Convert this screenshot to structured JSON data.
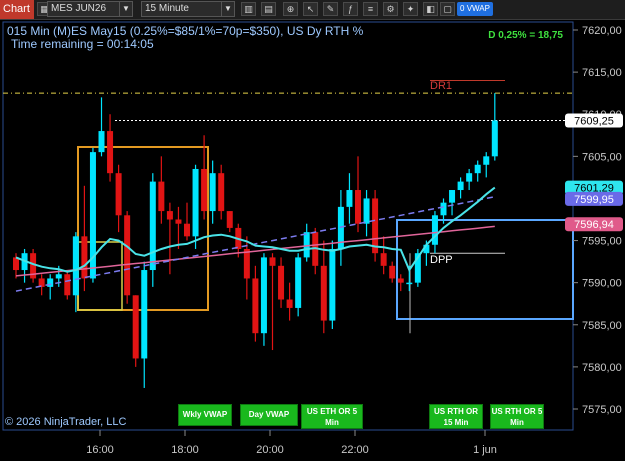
{
  "toolbar": {
    "chart_label": "Chart",
    "instrument": "MES JUN26",
    "interval": "15 Minute",
    "vwap_button": "0 VWAP"
  },
  "header": {
    "line1": "015 Min (M)ES May15  (0.25%=$85/1%=70p=$350), US Dy RTH %",
    "line2": "Time remaining = 00:14:05",
    "stat": "D 0,25% = 18,75"
  },
  "labels": {
    "dr1": "DR1",
    "dpp": "DPP",
    "copyright": "© 2026 NinjaTrader, LLC"
  },
  "price_axis": {
    "ticks": [
      "7620,00",
      "7615,00",
      "7610,00",
      "7605,00",
      "7600,00",
      "7595,00",
      "7590,00",
      "7585,00",
      "7580,00",
      "7575,00"
    ],
    "markers": [
      {
        "label": "7609,25",
        "color": "#ffffff",
        "text_color": "#000000"
      },
      {
        "label": "7601,29",
        "color": "#2ee6ee",
        "text_color": "#000000"
      },
      {
        "label": "7599,95",
        "color": "#6a6ae8",
        "text_color": "#ffffff"
      },
      {
        "label": "7596,94",
        "color": "#e05a8a",
        "text_color": "#ffffff"
      }
    ]
  },
  "time_axis": {
    "ticks": [
      "16:00",
      "18:00",
      "20:00",
      "22:00",
      "1 jun"
    ]
  },
  "buttons": [
    {
      "label": "Wkly VWAP"
    },
    {
      "label": "Day VWAP"
    },
    {
      "label": "US ETH OR 5 Min"
    },
    {
      "label": "US RTH OR 15 Min"
    },
    {
      "label": "US RTH OR 5 Min"
    }
  ],
  "colors": {
    "up": "#00e5ff",
    "down": "#e11414",
    "vwap": "#49e3e8",
    "dr1": "#c0392b"
  },
  "chart_data": {
    "type": "candlestick",
    "ylim": [
      7572,
      7622
    ],
    "ohlc": [
      [
        7593.0,
        7593.5,
        7590.5,
        7591.5
      ],
      [
        7591.5,
        7594.0,
        7590.0,
        7593.5
      ],
      [
        7593.5,
        7594.0,
        7590.0,
        7590.5
      ],
      [
        7590.5,
        7591.0,
        7588.5,
        7589.5
      ],
      [
        7589.5,
        7591.0,
        7588.0,
        7590.5
      ],
      [
        7590.5,
        7592.0,
        7589.5,
        7591.0
      ],
      [
        7591.0,
        7591.5,
        7588.0,
        7588.5
      ],
      [
        7588.5,
        7596.0,
        7586.5,
        7595.5
      ],
      [
        7595.5,
        7601.5,
        7589.0,
        7590.5
      ],
      [
        7590.5,
        7606.0,
        7590.0,
        7605.5
      ],
      [
        7605.5,
        7612.0,
        7605.0,
        7608.0
      ],
      [
        7608.0,
        7610.0,
        7602.0,
        7603.0
      ],
      [
        7603.0,
        7604.0,
        7596.0,
        7598.0
      ],
      [
        7598.0,
        7598.5,
        7587.5,
        7588.5
      ],
      [
        7588.5,
        7588.5,
        7580.0,
        7581.0
      ],
      [
        7581.0,
        7592.5,
        7577.5,
        7591.5
      ],
      [
        7591.5,
        7603.0,
        7589.5,
        7602.0
      ],
      [
        7602.0,
        7605.0,
        7597.0,
        7598.5
      ],
      [
        7598.5,
        7599.5,
        7591.0,
        7597.5
      ],
      [
        7597.5,
        7599.0,
        7594.0,
        7597.0
      ],
      [
        7597.0,
        7599.5,
        7595.0,
        7595.5
      ],
      [
        7595.5,
        7604.0,
        7594.0,
        7603.5
      ],
      [
        7603.5,
        7607.5,
        7597.5,
        7598.5
      ],
      [
        7598.5,
        7604.5,
        7597.0,
        7603.0
      ],
      [
        7603.0,
        7604.0,
        7597.5,
        7598.5
      ],
      [
        7598.5,
        7598.5,
        7596.0,
        7596.5
      ],
      [
        7596.5,
        7597.0,
        7593.0,
        7594.0
      ],
      [
        7594.0,
        7595.5,
        7588.0,
        7590.5
      ],
      [
        7590.5,
        7592.0,
        7583.0,
        7584.0
      ],
      [
        7584.0,
        7593.5,
        7582.5,
        7593.0
      ],
      [
        7593.0,
        7593.5,
        7582.0,
        7592.0
      ],
      [
        7592.0,
        7593.0,
        7587.0,
        7588.0
      ],
      [
        7588.0,
        7590.0,
        7585.5,
        7587.0
      ],
      [
        7587.0,
        7593.5,
        7586.0,
        7593.0
      ],
      [
        7593.0,
        7597.0,
        7592.5,
        7596.0
      ],
      [
        7596.0,
        7596.5,
        7591.0,
        7592.0
      ],
      [
        7592.0,
        7595.0,
        7584.0,
        7585.5
      ],
      [
        7585.5,
        7595.0,
        7584.5,
        7594.0
      ],
      [
        7594.0,
        7601.0,
        7592.0,
        7599.0
      ],
      [
        7599.0,
        7603.0,
        7597.0,
        7601.0
      ],
      [
        7601.0,
        7605.0,
        7596.0,
        7597.0
      ],
      [
        7597.0,
        7601.0,
        7595.5,
        7600.0
      ],
      [
        7600.0,
        7601.0,
        7592.5,
        7593.5
      ],
      [
        7593.5,
        7595.5,
        7591.0,
        7592.0
      ],
      [
        7592.0,
        7592.5,
        7590.0,
        7590.5
      ],
      [
        7590.5,
        7591.0,
        7589.0,
        7590.0
      ],
      [
        7590.0,
        7592.0,
        7589.0,
        7590.0
      ],
      [
        7590.0,
        7594.0,
        7589.5,
        7593.5
      ],
      [
        7593.5,
        7595.0,
        7592.0,
        7594.5
      ],
      [
        7594.5,
        7598.5,
        7593.5,
        7598.0
      ],
      [
        7598.0,
        7600.0,
        7597.0,
        7599.5
      ],
      [
        7599.5,
        7601.0,
        7598.0,
        7601.0
      ],
      [
        7601.0,
        7602.5,
        7600.0,
        7602.0
      ],
      [
        7602.0,
        7603.5,
        7601.0,
        7603.0
      ],
      [
        7603.0,
        7604.5,
        7602.0,
        7604.0
      ],
      [
        7604.0,
        7605.5,
        7602.5,
        7605.0
      ],
      [
        7605.0,
        7612.5,
        7604.5,
        7609.25
      ]
    ],
    "levels": {
      "dr1": 7614.0,
      "dotted": 7612.5,
      "last": 7609.25,
      "dpp": 7593.5
    }
  }
}
